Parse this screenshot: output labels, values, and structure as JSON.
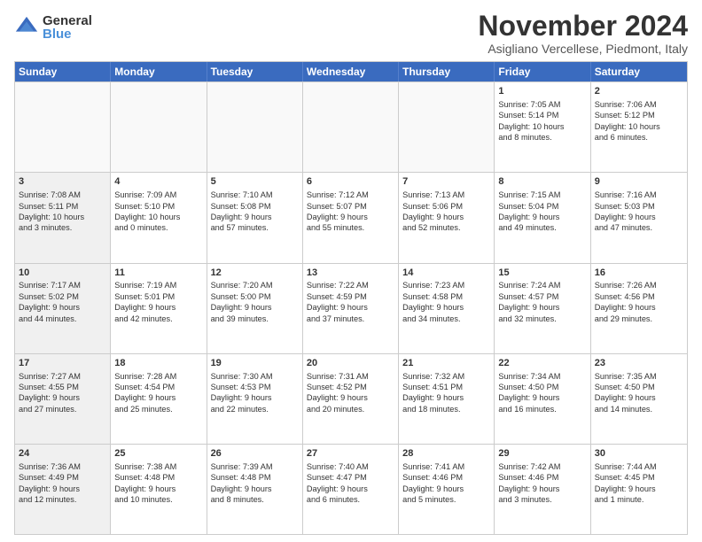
{
  "logo": {
    "general": "General",
    "blue": "Blue"
  },
  "title": "November 2024",
  "location": "Asigliano Vercellese, Piedmont, Italy",
  "days_header": [
    "Sunday",
    "Monday",
    "Tuesday",
    "Wednesday",
    "Thursday",
    "Friday",
    "Saturday"
  ],
  "weeks": [
    [
      {
        "day": "",
        "text": "",
        "shaded": true
      },
      {
        "day": "",
        "text": "",
        "shaded": true
      },
      {
        "day": "",
        "text": "",
        "shaded": true
      },
      {
        "day": "",
        "text": "",
        "shaded": true
      },
      {
        "day": "",
        "text": "",
        "shaded": true
      },
      {
        "day": "1",
        "text": "Sunrise: 7:05 AM\nSunset: 5:14 PM\nDaylight: 10 hours\nand 8 minutes.",
        "shaded": false
      },
      {
        "day": "2",
        "text": "Sunrise: 7:06 AM\nSunset: 5:12 PM\nDaylight: 10 hours\nand 6 minutes.",
        "shaded": false
      }
    ],
    [
      {
        "day": "3",
        "text": "Sunrise: 7:08 AM\nSunset: 5:11 PM\nDaylight: 10 hours\nand 3 minutes.",
        "shaded": true
      },
      {
        "day": "4",
        "text": "Sunrise: 7:09 AM\nSunset: 5:10 PM\nDaylight: 10 hours\nand 0 minutes.",
        "shaded": false
      },
      {
        "day": "5",
        "text": "Sunrise: 7:10 AM\nSunset: 5:08 PM\nDaylight: 9 hours\nand 57 minutes.",
        "shaded": false
      },
      {
        "day": "6",
        "text": "Sunrise: 7:12 AM\nSunset: 5:07 PM\nDaylight: 9 hours\nand 55 minutes.",
        "shaded": false
      },
      {
        "day": "7",
        "text": "Sunrise: 7:13 AM\nSunset: 5:06 PM\nDaylight: 9 hours\nand 52 minutes.",
        "shaded": false
      },
      {
        "day": "8",
        "text": "Sunrise: 7:15 AM\nSunset: 5:04 PM\nDaylight: 9 hours\nand 49 minutes.",
        "shaded": false
      },
      {
        "day": "9",
        "text": "Sunrise: 7:16 AM\nSunset: 5:03 PM\nDaylight: 9 hours\nand 47 minutes.",
        "shaded": false
      }
    ],
    [
      {
        "day": "10",
        "text": "Sunrise: 7:17 AM\nSunset: 5:02 PM\nDaylight: 9 hours\nand 44 minutes.",
        "shaded": true
      },
      {
        "day": "11",
        "text": "Sunrise: 7:19 AM\nSunset: 5:01 PM\nDaylight: 9 hours\nand 42 minutes.",
        "shaded": false
      },
      {
        "day": "12",
        "text": "Sunrise: 7:20 AM\nSunset: 5:00 PM\nDaylight: 9 hours\nand 39 minutes.",
        "shaded": false
      },
      {
        "day": "13",
        "text": "Sunrise: 7:22 AM\nSunset: 4:59 PM\nDaylight: 9 hours\nand 37 minutes.",
        "shaded": false
      },
      {
        "day": "14",
        "text": "Sunrise: 7:23 AM\nSunset: 4:58 PM\nDaylight: 9 hours\nand 34 minutes.",
        "shaded": false
      },
      {
        "day": "15",
        "text": "Sunrise: 7:24 AM\nSunset: 4:57 PM\nDaylight: 9 hours\nand 32 minutes.",
        "shaded": false
      },
      {
        "day": "16",
        "text": "Sunrise: 7:26 AM\nSunset: 4:56 PM\nDaylight: 9 hours\nand 29 minutes.",
        "shaded": false
      }
    ],
    [
      {
        "day": "17",
        "text": "Sunrise: 7:27 AM\nSunset: 4:55 PM\nDaylight: 9 hours\nand 27 minutes.",
        "shaded": true
      },
      {
        "day": "18",
        "text": "Sunrise: 7:28 AM\nSunset: 4:54 PM\nDaylight: 9 hours\nand 25 minutes.",
        "shaded": false
      },
      {
        "day": "19",
        "text": "Sunrise: 7:30 AM\nSunset: 4:53 PM\nDaylight: 9 hours\nand 22 minutes.",
        "shaded": false
      },
      {
        "day": "20",
        "text": "Sunrise: 7:31 AM\nSunset: 4:52 PM\nDaylight: 9 hours\nand 20 minutes.",
        "shaded": false
      },
      {
        "day": "21",
        "text": "Sunrise: 7:32 AM\nSunset: 4:51 PM\nDaylight: 9 hours\nand 18 minutes.",
        "shaded": false
      },
      {
        "day": "22",
        "text": "Sunrise: 7:34 AM\nSunset: 4:50 PM\nDaylight: 9 hours\nand 16 minutes.",
        "shaded": false
      },
      {
        "day": "23",
        "text": "Sunrise: 7:35 AM\nSunset: 4:50 PM\nDaylight: 9 hours\nand 14 minutes.",
        "shaded": false
      }
    ],
    [
      {
        "day": "24",
        "text": "Sunrise: 7:36 AM\nSunset: 4:49 PM\nDaylight: 9 hours\nand 12 minutes.",
        "shaded": true
      },
      {
        "day": "25",
        "text": "Sunrise: 7:38 AM\nSunset: 4:48 PM\nDaylight: 9 hours\nand 10 minutes.",
        "shaded": false
      },
      {
        "day": "26",
        "text": "Sunrise: 7:39 AM\nSunset: 4:48 PM\nDaylight: 9 hours\nand 8 minutes.",
        "shaded": false
      },
      {
        "day": "27",
        "text": "Sunrise: 7:40 AM\nSunset: 4:47 PM\nDaylight: 9 hours\nand 6 minutes.",
        "shaded": false
      },
      {
        "day": "28",
        "text": "Sunrise: 7:41 AM\nSunset: 4:46 PM\nDaylight: 9 hours\nand 5 minutes.",
        "shaded": false
      },
      {
        "day": "29",
        "text": "Sunrise: 7:42 AM\nSunset: 4:46 PM\nDaylight: 9 hours\nand 3 minutes.",
        "shaded": false
      },
      {
        "day": "30",
        "text": "Sunrise: 7:44 AM\nSunset: 4:45 PM\nDaylight: 9 hours\nand 1 minute.",
        "shaded": false
      }
    ]
  ]
}
